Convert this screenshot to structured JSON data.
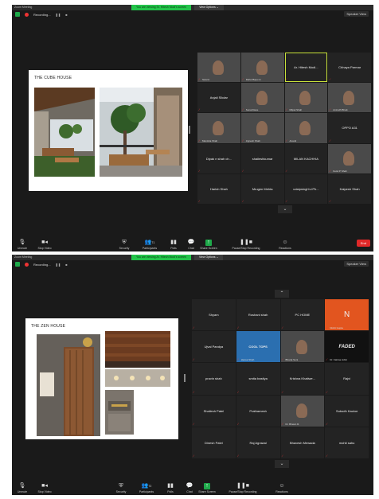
{
  "colors": {
    "accent_green": "#23c44a",
    "end_red": "#e02828",
    "active_outline": "#c9e23a"
  },
  "shot1": {
    "title": "Zoom Meeting",
    "banner": "You are viewing Sr. Hitesh Modi's screen",
    "view_options": "View Options ⌄",
    "recording": "Recording...",
    "speaker_view": "Speaker View",
    "slide_title": "THE CUBE HOUSE",
    "tiles": [
      {
        "name": "",
        "sub": "Swami",
        "video": true
      },
      {
        "name": "",
        "sub": "Rahul Bapu H.",
        "video": true
      },
      {
        "name": "Ar. Hitesh Modi...",
        "sub": "",
        "video": false,
        "active": true
      },
      {
        "name": "Chhaya Parmar",
        "sub": "",
        "video": false
      },
      {
        "name": "Anjali Sikdar",
        "sub": "",
        "video": false
      },
      {
        "name": "",
        "sub": "Sonal Dave",
        "video": true
      },
      {
        "name": "",
        "sub": "Milpal Shah",
        "video": true
      },
      {
        "name": "",
        "sub": "Anirudh Bhatt",
        "video": true
      },
      {
        "name": "",
        "sub": "Manisha Shah",
        "video": true
      },
      {
        "name": "",
        "sub": "Jignesh Shah",
        "video": true
      },
      {
        "name": "",
        "sub": "Anand",
        "video": true
      },
      {
        "name": "OPPO A31",
        "sub": "",
        "video": false
      },
      {
        "name": "Dipak n shah ch...",
        "sub": "",
        "video": false
      },
      {
        "name": "shaileshkumar",
        "sub": "",
        "video": false
      },
      {
        "name": "MILAN KACHHIA",
        "sub": "",
        "video": false
      },
      {
        "name": "",
        "sub": "Ketul P Shah",
        "video": true
      },
      {
        "name": "Harish Shah",
        "sub": "",
        "video": false
      },
      {
        "name": "Mrugen Mehta",
        "sub": "",
        "video": false
      },
      {
        "name": "udaipsingh's iPh...",
        "sub": "",
        "video": false
      },
      {
        "name": "Kalpesh Shah",
        "sub": "",
        "video": false
      }
    ],
    "toolbar": {
      "unmute": "Unmute",
      "stop_video": "Stop Video",
      "security": "Security",
      "participants": "Participants",
      "participants_count": "71",
      "polls": "Polls",
      "chat": "Chat",
      "share_screen": "Share Screen",
      "pause_recording": "Pause/Stop Recording",
      "reactions": "Reactions",
      "end": "End"
    }
  },
  "shot2": {
    "title": "Zoom Meeting",
    "banner": "You are viewing Ar. Hitesh Modi's screen",
    "view_options": "View Options ⌄",
    "recording": "Recording...",
    "speaker_view": "Speaker View",
    "slide_title": "THE ZEN HOUSE",
    "tiles": [
      {
        "name": "Shyam",
        "sub": "",
        "video": false
      },
      {
        "name": "Roshani shah",
        "sub": "",
        "video": false
      },
      {
        "name": "PC HOME",
        "sub": "",
        "video": false
      },
      {
        "name": "N",
        "sub": "Nishit Gupta",
        "video": false,
        "orange": true
      },
      {
        "name": "Ujval Pandya",
        "sub": "",
        "video": false
      },
      {
        "name": "COOL TOPS",
        "sub": "Hansa Shah",
        "video": false,
        "logo": true
      },
      {
        "name": "",
        "sub": "Bharat Soni",
        "video": true
      },
      {
        "name": "FADED",
        "sub": "Dr. Fatima Jobin",
        "video": false,
        "faded": true
      },
      {
        "name": "pravin shah",
        "sub": "",
        "video": false
      },
      {
        "name": "smita bastiya",
        "sub": "",
        "video": false
      },
      {
        "name": "Krishna Khatiwe...",
        "sub": "",
        "video": false
      },
      {
        "name": "Rajvi",
        "sub": "",
        "video": false
      },
      {
        "name": "Shailesh Patel",
        "sub": "",
        "video": false
      },
      {
        "name": "Prathamesh",
        "sub": "",
        "video": false
      },
      {
        "name": "",
        "sub": "Dr. Bhavin R.",
        "video": true
      },
      {
        "name": "Subodh Kackor",
        "sub": "",
        "video": false
      },
      {
        "name": "Dinesh Patel",
        "sub": "",
        "video": false
      },
      {
        "name": "Raj Agrawal",
        "sub": "",
        "video": false
      },
      {
        "name": "Bhavesh Mewada",
        "sub": "",
        "video": false
      },
      {
        "name": "mohit sahu",
        "sub": "",
        "video": false
      }
    ],
    "toolbar": {
      "unmute": "Unmute",
      "stop_video": "Stop Video",
      "security": "Security",
      "participants": "Participants",
      "participants_count": "72",
      "polls": "Polls",
      "chat": "Chat",
      "share_screen": "Share Screen",
      "pause_recording": "Pause/Stop Recording",
      "reactions": "Reactions",
      "end": "End"
    }
  }
}
